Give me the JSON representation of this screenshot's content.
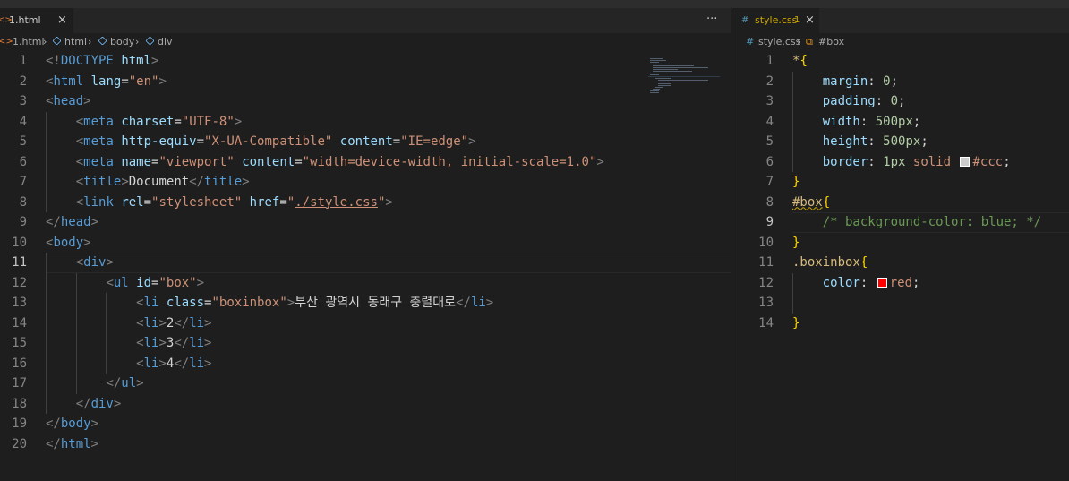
{
  "colors": {
    "editor_bg": "#1e1e1e",
    "tag": "#569cd6",
    "attr": "#9cdcfe",
    "string": "#ce9178",
    "selector": "#d7ba7d",
    "number": "#b5cea8",
    "comment": "#6a9955",
    "html_icon": "#e37933",
    "css_icon": "#519aba",
    "red_swatch": "#ff0000",
    "ccc_swatch": "#cccccc"
  },
  "left": {
    "tab": {
      "icon": "<>",
      "name": "1.html",
      "close": "×"
    },
    "more": "···",
    "breadcrumb": {
      "file_icon": "<>",
      "file": "1.html",
      "html": "html",
      "body": "body",
      "div": "div",
      "sep": "›"
    },
    "current_line": 11,
    "lines": [
      {
        "n": "1",
        "t": [
          [
            "br",
            "<!"
          ],
          [
            "tg",
            "DOCTYPE"
          ],
          [
            "tx",
            " "
          ],
          [
            "at",
            "html"
          ],
          [
            "br",
            ">"
          ]
        ]
      },
      {
        "n": "2",
        "t": [
          [
            "br",
            "<"
          ],
          [
            "tg",
            "html"
          ],
          [
            "tx",
            " "
          ],
          [
            "at",
            "lang"
          ],
          [
            "tx",
            "="
          ],
          [
            "st",
            "\"en\""
          ],
          [
            "br",
            ">"
          ]
        ]
      },
      {
        "n": "3",
        "t": [
          [
            "br",
            "<"
          ],
          [
            "tg",
            "head"
          ],
          [
            "br",
            ">"
          ]
        ]
      },
      {
        "n": "4",
        "t": [
          [
            "tx",
            "    "
          ],
          [
            "br",
            "<"
          ],
          [
            "tg",
            "meta"
          ],
          [
            "tx",
            " "
          ],
          [
            "at",
            "charset"
          ],
          [
            "tx",
            "="
          ],
          [
            "st",
            "\"UTF-8\""
          ],
          [
            "br",
            ">"
          ]
        ]
      },
      {
        "n": "5",
        "t": [
          [
            "tx",
            "    "
          ],
          [
            "br",
            "<"
          ],
          [
            "tg",
            "meta"
          ],
          [
            "tx",
            " "
          ],
          [
            "at",
            "http-equiv"
          ],
          [
            "tx",
            "="
          ],
          [
            "st",
            "\"X-UA-Compatible\""
          ],
          [
            "tx",
            " "
          ],
          [
            "at",
            "content"
          ],
          [
            "tx",
            "="
          ],
          [
            "st",
            "\"IE=edge\""
          ],
          [
            "br",
            ">"
          ]
        ]
      },
      {
        "n": "6",
        "t": [
          [
            "tx",
            "    "
          ],
          [
            "br",
            "<"
          ],
          [
            "tg",
            "meta"
          ],
          [
            "tx",
            " "
          ],
          [
            "at",
            "name"
          ],
          [
            "tx",
            "="
          ],
          [
            "st",
            "\"viewport\""
          ],
          [
            "tx",
            " "
          ],
          [
            "at",
            "content"
          ],
          [
            "tx",
            "="
          ],
          [
            "st",
            "\"width=device-width, initial-scale=1.0\""
          ],
          [
            "br",
            ">"
          ]
        ]
      },
      {
        "n": "7",
        "t": [
          [
            "tx",
            "    "
          ],
          [
            "br",
            "<"
          ],
          [
            "tg",
            "title"
          ],
          [
            "br",
            ">"
          ],
          [
            "tx",
            "Document"
          ],
          [
            "br",
            "</"
          ],
          [
            "tg",
            "title"
          ],
          [
            "br",
            ">"
          ]
        ]
      },
      {
        "n": "8",
        "t": [
          [
            "tx",
            "    "
          ],
          [
            "br",
            "<"
          ],
          [
            "tg",
            "link"
          ],
          [
            "tx",
            " "
          ],
          [
            "at",
            "rel"
          ],
          [
            "tx",
            "="
          ],
          [
            "st",
            "\"stylesheet\""
          ],
          [
            "tx",
            " "
          ],
          [
            "at",
            "href"
          ],
          [
            "tx",
            "="
          ],
          [
            "st",
            "\""
          ],
          [
            "stl",
            "./style.css"
          ],
          [
            "st",
            "\""
          ],
          [
            "br",
            ">"
          ]
        ]
      },
      {
        "n": "9",
        "t": [
          [
            "br",
            "</"
          ],
          [
            "tg",
            "head"
          ],
          [
            "br",
            ">"
          ]
        ]
      },
      {
        "n": "10",
        "t": [
          [
            "br",
            "<"
          ],
          [
            "tg",
            "body"
          ],
          [
            "br",
            ">"
          ]
        ]
      },
      {
        "n": "11",
        "t": [
          [
            "tx",
            "    "
          ],
          [
            "br",
            "<"
          ],
          [
            "tg",
            "div"
          ],
          [
            "br",
            ">"
          ]
        ]
      },
      {
        "n": "12",
        "t": [
          [
            "tx",
            "        "
          ],
          [
            "br",
            "<"
          ],
          [
            "tg",
            "ul"
          ],
          [
            "tx",
            " "
          ],
          [
            "at",
            "id"
          ],
          [
            "tx",
            "="
          ],
          [
            "st",
            "\"box\""
          ],
          [
            "br",
            ">"
          ]
        ]
      },
      {
        "n": "13",
        "t": [
          [
            "tx",
            "            "
          ],
          [
            "br",
            "<"
          ],
          [
            "tg",
            "li"
          ],
          [
            "tx",
            " "
          ],
          [
            "at",
            "class"
          ],
          [
            "tx",
            "="
          ],
          [
            "st",
            "\"boxinbox\""
          ],
          [
            "br",
            ">"
          ],
          [
            "tx",
            "부산 광역시 동래구 충렬대로"
          ],
          [
            "br",
            "</"
          ],
          [
            "tg",
            "li"
          ],
          [
            "br",
            ">"
          ]
        ]
      },
      {
        "n": "14",
        "t": [
          [
            "tx",
            "            "
          ],
          [
            "br",
            "<"
          ],
          [
            "tg",
            "li"
          ],
          [
            "br",
            ">"
          ],
          [
            "tx",
            "2"
          ],
          [
            "br",
            "</"
          ],
          [
            "tg",
            "li"
          ],
          [
            "br",
            ">"
          ]
        ]
      },
      {
        "n": "15",
        "t": [
          [
            "tx",
            "            "
          ],
          [
            "br",
            "<"
          ],
          [
            "tg",
            "li"
          ],
          [
            "br",
            ">"
          ],
          [
            "tx",
            "3"
          ],
          [
            "br",
            "</"
          ],
          [
            "tg",
            "li"
          ],
          [
            "br",
            ">"
          ]
        ]
      },
      {
        "n": "16",
        "t": [
          [
            "tx",
            "            "
          ],
          [
            "br",
            "<"
          ],
          [
            "tg",
            "li"
          ],
          [
            "br",
            ">"
          ],
          [
            "tx",
            "4"
          ],
          [
            "br",
            "</"
          ],
          [
            "tg",
            "li"
          ],
          [
            "br",
            ">"
          ]
        ]
      },
      {
        "n": "17",
        "t": [
          [
            "tx",
            "        "
          ],
          [
            "br",
            "</"
          ],
          [
            "tg",
            "ul"
          ],
          [
            "br",
            ">"
          ]
        ]
      },
      {
        "n": "18",
        "t": [
          [
            "tx",
            "    "
          ],
          [
            "br",
            "</"
          ],
          [
            "tg",
            "div"
          ],
          [
            "br",
            ">"
          ]
        ]
      },
      {
        "n": "19",
        "t": [
          [
            "br",
            "</"
          ],
          [
            "tg",
            "body"
          ],
          [
            "br",
            ">"
          ]
        ]
      },
      {
        "n": "20",
        "t": [
          [
            "br",
            "</"
          ],
          [
            "tg",
            "html"
          ],
          [
            "br",
            ">"
          ]
        ]
      }
    ]
  },
  "right": {
    "tab": {
      "icon": "#",
      "name": "style.css",
      "badge": "1",
      "close": "×"
    },
    "breadcrumb": {
      "file_icon": "#",
      "file": "style.css",
      "sep": "›",
      "selector_icon": "⧉",
      "selector": "#box"
    },
    "current_line": 9,
    "lines": [
      {
        "n": "1",
        "t": [
          [
            "sel",
            "*"
          ],
          [
            "bk",
            "{"
          ]
        ]
      },
      {
        "n": "2",
        "t": [
          [
            "tx",
            "    "
          ],
          [
            "pr",
            "margin"
          ],
          [
            "tx",
            ": "
          ],
          [
            "nu",
            "0"
          ],
          [
            "tx",
            ";"
          ]
        ]
      },
      {
        "n": "3",
        "t": [
          [
            "tx",
            "    "
          ],
          [
            "pr",
            "padding"
          ],
          [
            "tx",
            ": "
          ],
          [
            "nu",
            "0"
          ],
          [
            "tx",
            ";"
          ]
        ]
      },
      {
        "n": "4",
        "t": [
          [
            "tx",
            "    "
          ],
          [
            "pr",
            "width"
          ],
          [
            "tx",
            ": "
          ],
          [
            "nu",
            "500px"
          ],
          [
            "tx",
            ";"
          ]
        ]
      },
      {
        "n": "5",
        "t": [
          [
            "tx",
            "    "
          ],
          [
            "pr",
            "height"
          ],
          [
            "tx",
            ": "
          ],
          [
            "nu",
            "500px"
          ],
          [
            "tx",
            ";"
          ]
        ]
      },
      {
        "n": "6",
        "t": [
          [
            "tx",
            "    "
          ],
          [
            "pr",
            "border"
          ],
          [
            "tx",
            ": "
          ],
          [
            "nu",
            "1px"
          ],
          [
            "tx",
            " "
          ],
          [
            "st",
            "solid"
          ],
          [
            "tx",
            " "
          ],
          [
            "sw",
            "#cccccc"
          ],
          [
            "st",
            "#ccc"
          ],
          [
            "tx",
            ";"
          ]
        ]
      },
      {
        "n": "7",
        "t": [
          [
            "bk",
            "}"
          ]
        ]
      },
      {
        "n": "8",
        "t": [
          [
            "selsq",
            "#box"
          ],
          [
            "bk",
            "{"
          ]
        ]
      },
      {
        "n": "9",
        "t": [
          [
            "tx",
            "    "
          ],
          [
            "cm",
            "/* background-color: blue; */"
          ]
        ]
      },
      {
        "n": "10",
        "t": [
          [
            "bk",
            "}"
          ]
        ]
      },
      {
        "n": "11",
        "t": [
          [
            "sel",
            ".boxinbox"
          ],
          [
            "bk",
            "{"
          ]
        ]
      },
      {
        "n": "12",
        "t": [
          [
            "tx",
            "    "
          ],
          [
            "pr",
            "color"
          ],
          [
            "tx",
            ": "
          ],
          [
            "sw",
            "#ff0000"
          ],
          [
            "st",
            "red"
          ],
          [
            "tx",
            ";"
          ]
        ]
      },
      {
        "n": "13",
        "t": []
      },
      {
        "n": "14",
        "t": [
          [
            "bk",
            "}"
          ]
        ]
      }
    ]
  }
}
